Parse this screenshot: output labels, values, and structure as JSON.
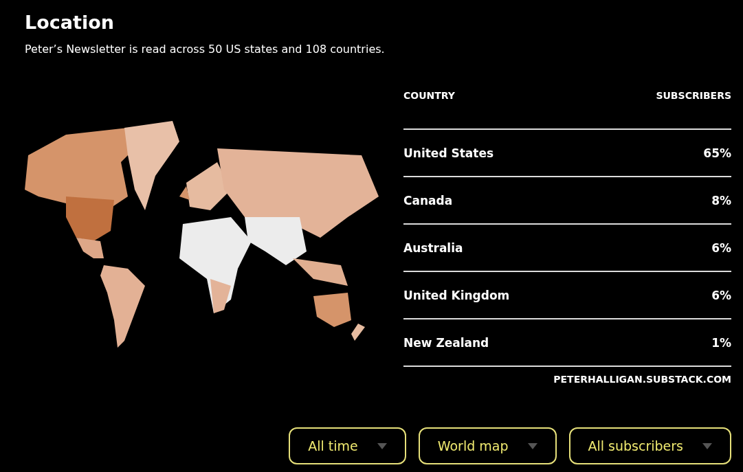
{
  "heading": "Location",
  "summary": "Peter’s Newsletter is read across 50 US states and 108 countries.",
  "table": {
    "columns": [
      "COUNTRY",
      "SUBSCRIBERS"
    ],
    "rows": [
      {
        "country": "United States",
        "share": "65%"
      },
      {
        "country": "Canada",
        "share": "8%"
      },
      {
        "country": "Australia",
        "share": "6%"
      },
      {
        "country": "United Kingdom",
        "share": "6%"
      },
      {
        "country": "New Zealand",
        "share": "1%"
      }
    ],
    "source": "PETERHALLIGAN.SUBSTACK.COM"
  },
  "filters": [
    {
      "label": "All time"
    },
    {
      "label": "World map"
    },
    {
      "label": "All subscribers"
    }
  ]
}
